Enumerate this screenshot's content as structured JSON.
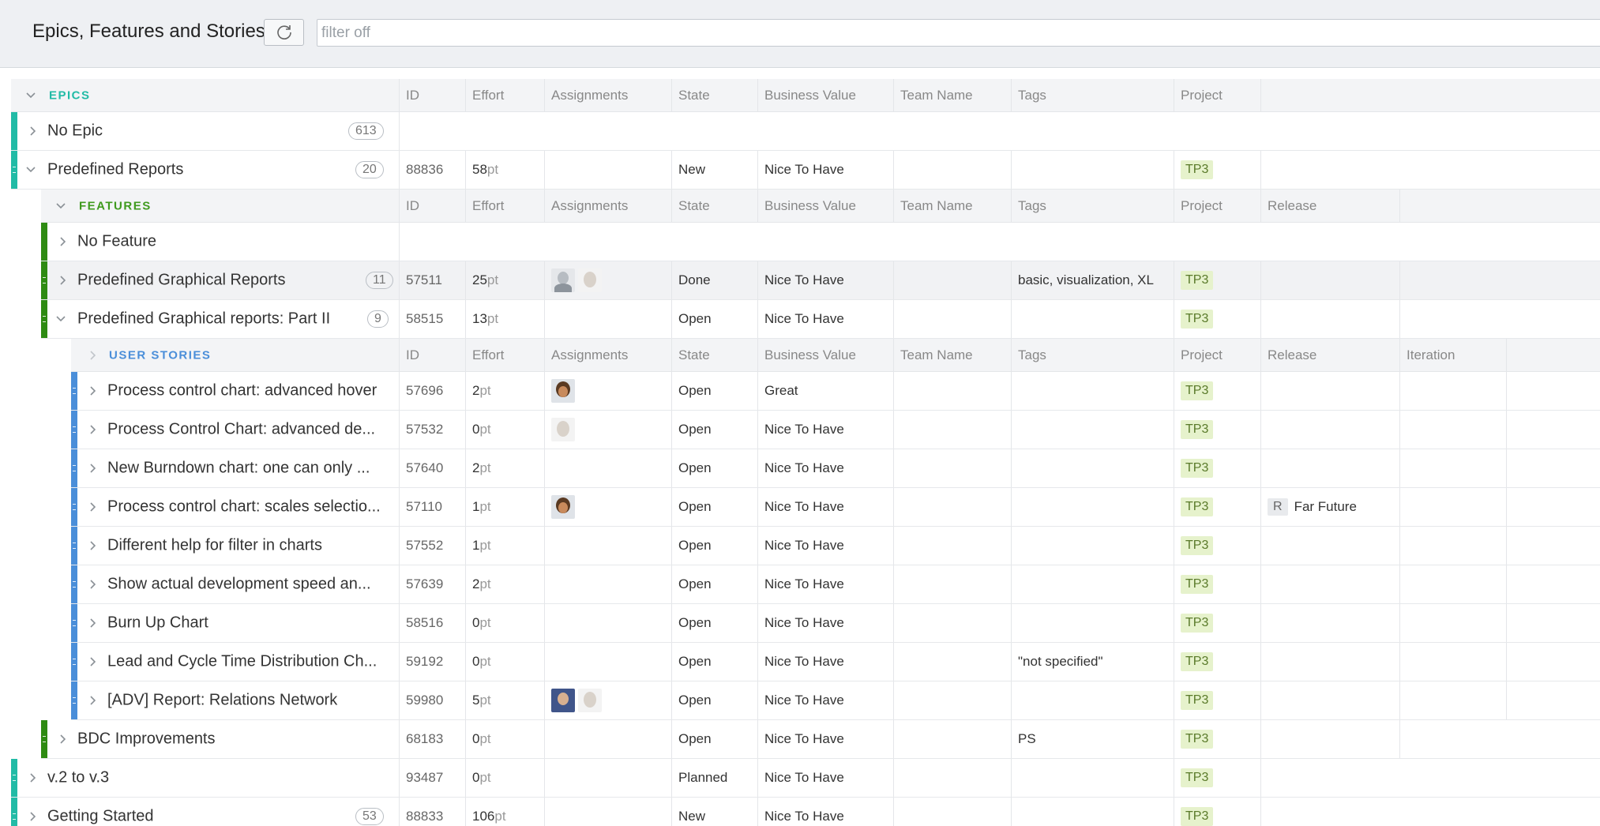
{
  "header": {
    "title": "Epics, Features and Stories"
  },
  "filter": {
    "placeholder": "filter off"
  },
  "groups": {
    "epics": "EPICS",
    "features": "FEATURES",
    "stories": "USER STORIES"
  },
  "columns": {
    "id": "ID",
    "effort": "Effort",
    "assignments": "Assignments",
    "state": "State",
    "business_value": "Business Value",
    "team_name": "Team Name",
    "tags": "Tags",
    "project": "Project",
    "release": "Release",
    "iteration": "Iteration"
  },
  "units": {
    "pt": "pt"
  },
  "rows": [
    {
      "name": "No Epic",
      "count": "613"
    },
    {
      "name": "Predefined Reports",
      "count": "20",
      "id": "88836",
      "effort": "58",
      "state": "New",
      "business_value": "Nice To Have",
      "project": "TP3"
    },
    {
      "name": "No Feature"
    },
    {
      "name": "Predefined Graphical Reports",
      "count": "11",
      "id": "57511",
      "effort": "25",
      "state": "Done",
      "business_value": "Nice To Have",
      "tags": "basic, visualization, XL",
      "project": "TP3"
    },
    {
      "name": "Predefined Graphical reports: Part II",
      "count": "9",
      "id": "58515",
      "effort": "13",
      "state": "Open",
      "business_value": "Nice To Have",
      "project": "TP3"
    },
    {
      "name": "Process control chart: advanced hover",
      "id": "57696",
      "effort": "2",
      "state": "Open",
      "business_value": "Great",
      "project": "TP3"
    },
    {
      "name": "Process Control Chart: advanced de...",
      "id": "57532",
      "effort": "0",
      "state": "Open",
      "business_value": "Nice To Have",
      "project": "TP3"
    },
    {
      "name": "New Burndown chart: one can only ...",
      "id": "57640",
      "effort": "2",
      "state": "Open",
      "business_value": "Nice To Have",
      "project": "TP3"
    },
    {
      "name": "Process control chart: scales selectio...",
      "id": "57110",
      "effort": "1",
      "state": "Open",
      "business_value": "Nice To Have",
      "project": "TP3",
      "release_badge": "R",
      "release": "Far Future"
    },
    {
      "name": "Different help for filter in charts",
      "id": "57552",
      "effort": "1",
      "state": "Open",
      "business_value": "Nice To Have",
      "project": "TP3"
    },
    {
      "name": "Show actual development speed an...",
      "id": "57639",
      "effort": "2",
      "state": "Open",
      "business_value": "Nice To Have",
      "project": "TP3"
    },
    {
      "name": "Burn Up Chart",
      "id": "58516",
      "effort": "0",
      "state": "Open",
      "business_value": "Nice To Have",
      "project": "TP3"
    },
    {
      "name": "Lead and Cycle Time Distribution Ch...",
      "id": "59192",
      "effort": "0",
      "state": "Open",
      "business_value": "Nice To Have",
      "tags": "\"not specified\"",
      "project": "TP3"
    },
    {
      "name": "[ADV] Report: Relations Network",
      "id": "59980",
      "effort": "5",
      "state": "Open",
      "business_value": "Nice To Have",
      "project": "TP3"
    },
    {
      "name": "BDC Improvements",
      "id": "68183",
      "effort": "0",
      "state": "Open",
      "business_value": "Nice To Have",
      "tags": "PS",
      "project": "TP3"
    },
    {
      "name": "v.2 to v.3",
      "id": "93487",
      "effort": "0",
      "state": "Planned",
      "business_value": "Nice To Have",
      "project": "TP3"
    },
    {
      "name": "Getting Started",
      "count": "53",
      "id": "88833",
      "effort": "106",
      "state": "New",
      "business_value": "Nice To Have",
      "project": "TP3"
    }
  ],
  "icons": {
    "refresh": "refresh-icon",
    "expand": "chevron-right-icon",
    "collapse": "chevron-down-icon"
  },
  "colors": {
    "epic": "#21bba6",
    "feature": "#2e8b12",
    "story": "#4a8ed9",
    "tag_bg": "#e6f2cc"
  }
}
